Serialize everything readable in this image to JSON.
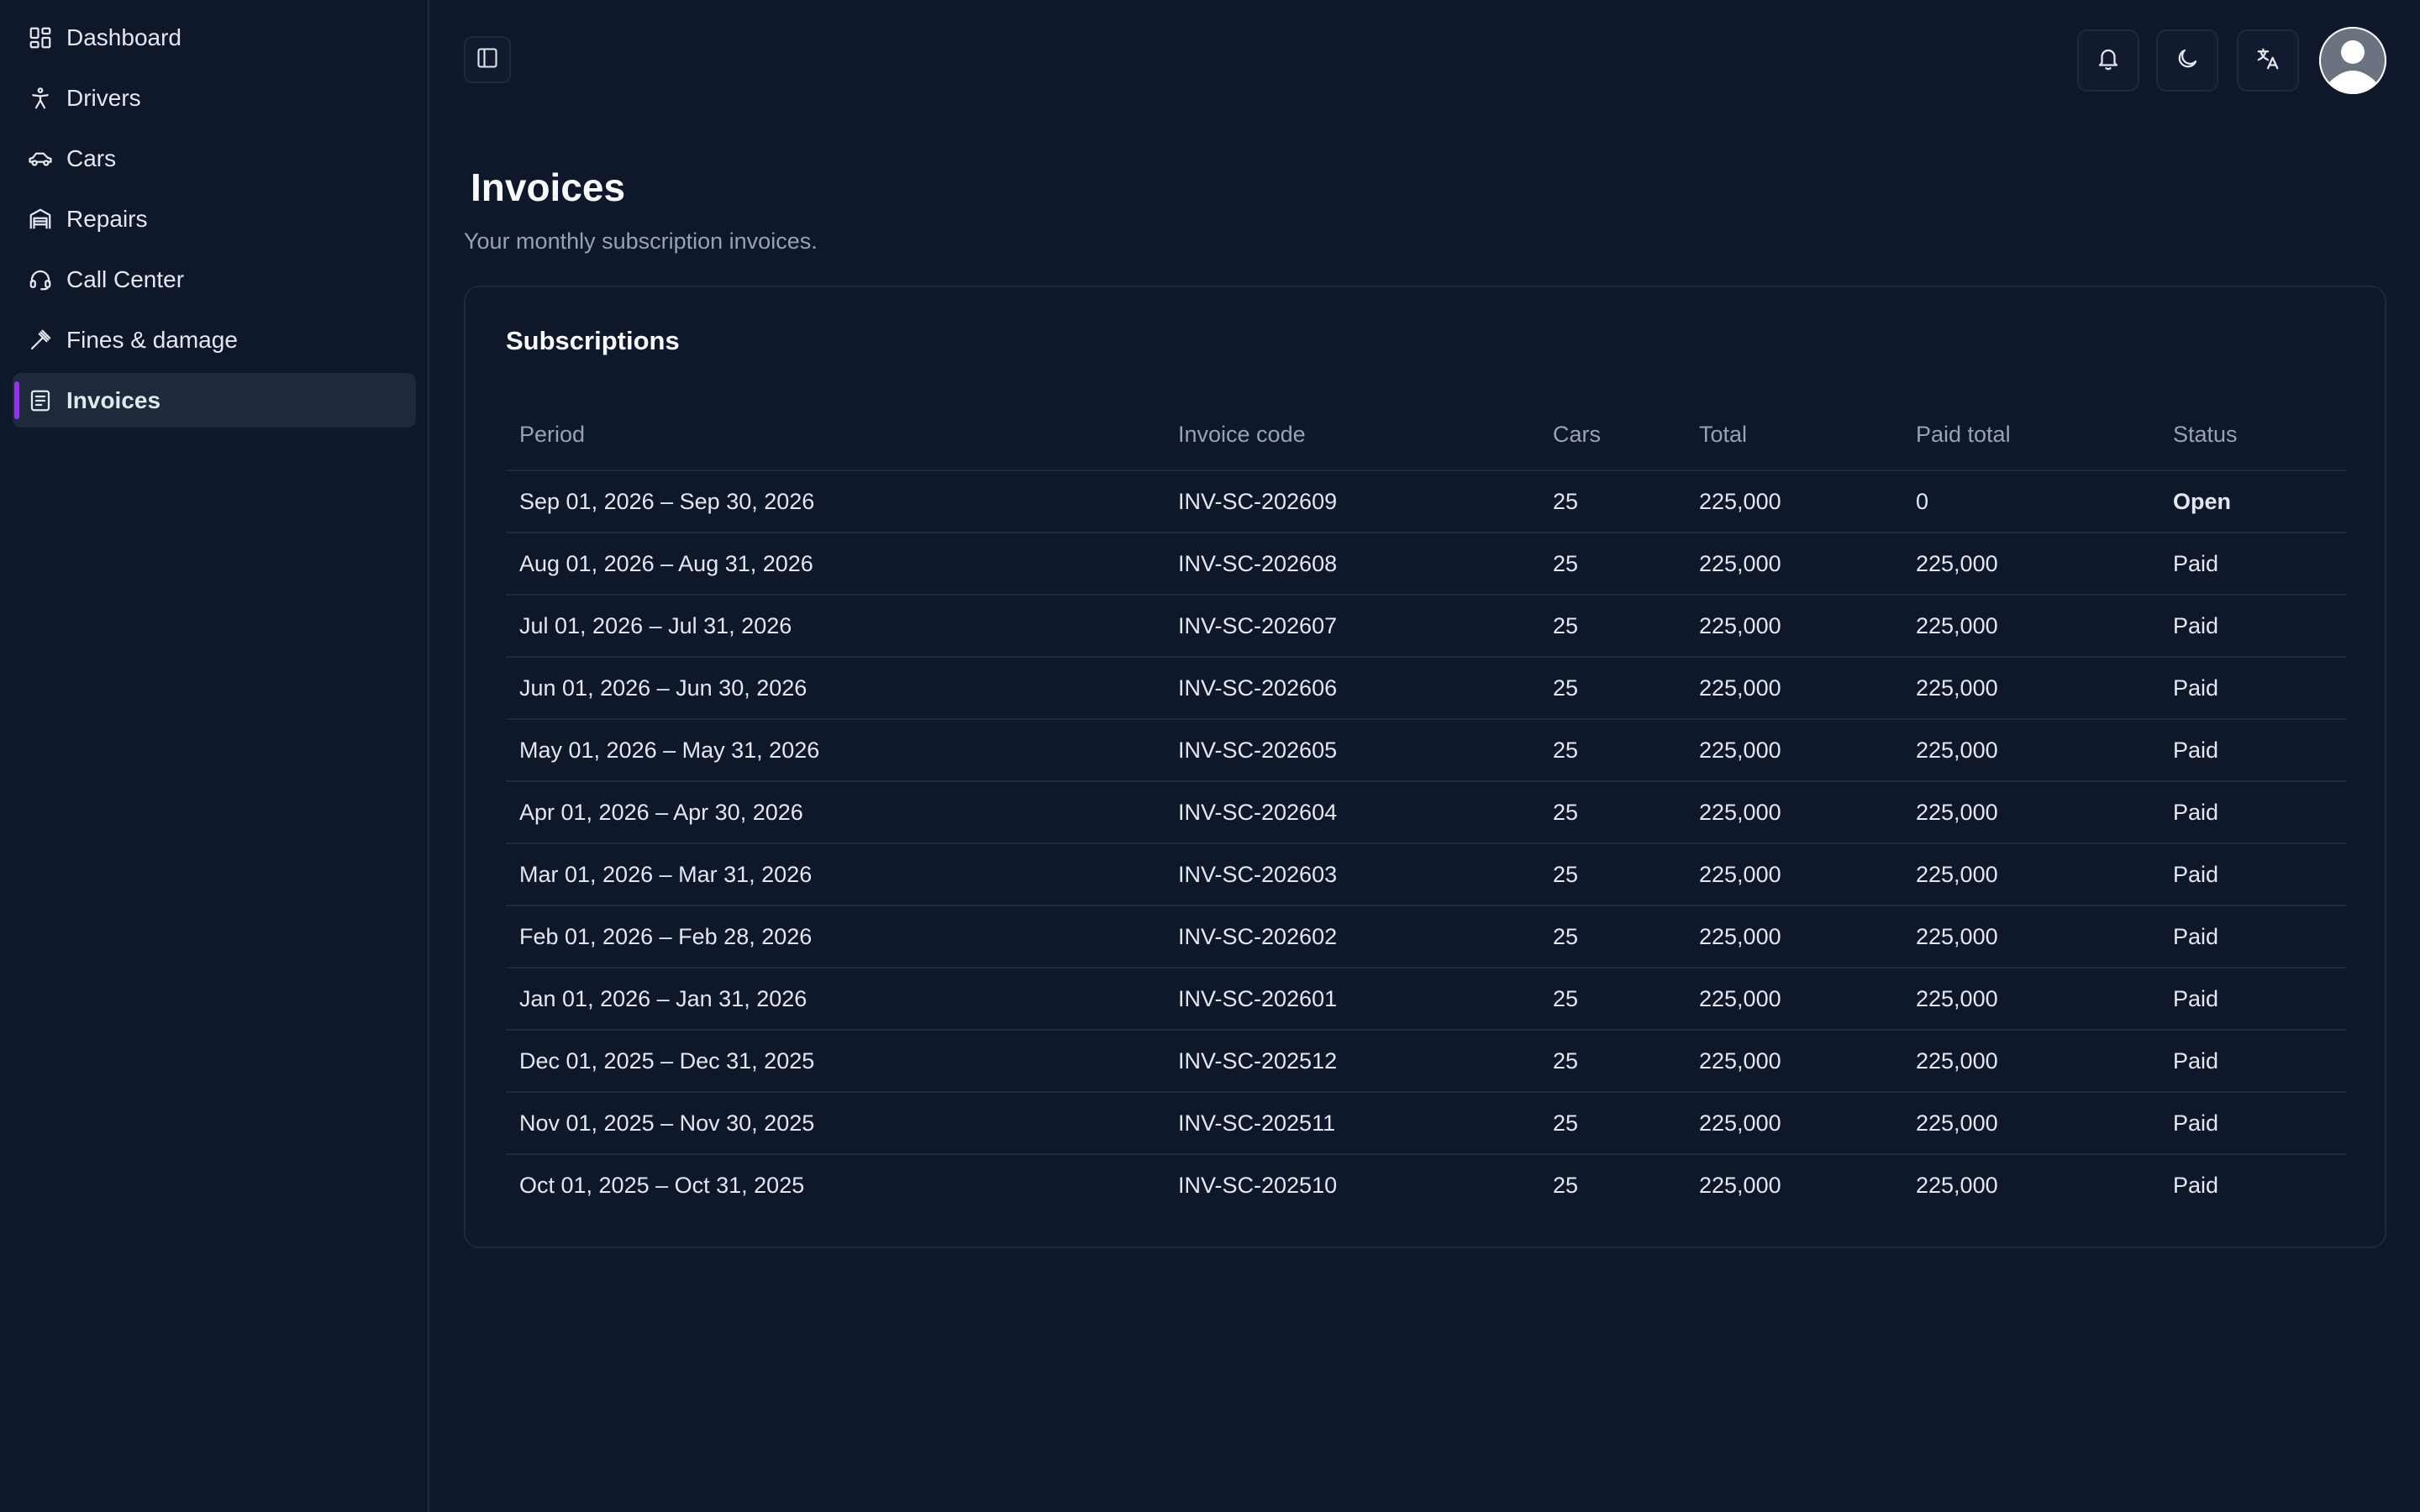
{
  "sidebar": {
    "items": [
      {
        "label": "Dashboard",
        "icon": "dashboard-icon"
      },
      {
        "label": "Drivers",
        "icon": "person-icon"
      },
      {
        "label": "Cars",
        "icon": "car-icon"
      },
      {
        "label": "Repairs",
        "icon": "garage-icon"
      },
      {
        "label": "Call Center",
        "icon": "headset-icon"
      },
      {
        "label": "Fines & damage",
        "icon": "gavel-icon"
      },
      {
        "label": "Invoices",
        "icon": "invoice-icon",
        "active": true
      }
    ]
  },
  "header": {
    "icons": [
      "sidebar-toggle-icon",
      "bell-icon",
      "moon-icon",
      "translate-icon",
      "avatar"
    ]
  },
  "page": {
    "title": "Invoices",
    "subtitle": "Your monthly subscription invoices."
  },
  "card": {
    "title": "Subscriptions",
    "columns": [
      "Period",
      "Invoice code",
      "Cars",
      "Total",
      "Paid total",
      "Status"
    ],
    "rows": [
      {
        "period": "Sep 01, 2026 – Sep 30, 2026",
        "code": "INV-SC-202609",
        "cars": "25",
        "total": "225,000",
        "paid": "0",
        "status": "Open"
      },
      {
        "period": "Aug 01, 2026 – Aug 31, 2026",
        "code": "INV-SC-202608",
        "cars": "25",
        "total": "225,000",
        "paid": "225,000",
        "status": "Paid"
      },
      {
        "period": "Jul 01, 2026 – Jul 31, 2026",
        "code": "INV-SC-202607",
        "cars": "25",
        "total": "225,000",
        "paid": "225,000",
        "status": "Paid"
      },
      {
        "period": "Jun 01, 2026 – Jun 30, 2026",
        "code": "INV-SC-202606",
        "cars": "25",
        "total": "225,000",
        "paid": "225,000",
        "status": "Paid"
      },
      {
        "period": "May 01, 2026 – May 31, 2026",
        "code": "INV-SC-202605",
        "cars": "25",
        "total": "225,000",
        "paid": "225,000",
        "status": "Paid"
      },
      {
        "period": "Apr 01, 2026 – Apr 30, 2026",
        "code": "INV-SC-202604",
        "cars": "25",
        "total": "225,000",
        "paid": "225,000",
        "status": "Paid"
      },
      {
        "period": "Mar 01, 2026 – Mar 31, 2026",
        "code": "INV-SC-202603",
        "cars": "25",
        "total": "225,000",
        "paid": "225,000",
        "status": "Paid"
      },
      {
        "period": "Feb 01, 2026 – Feb 28, 2026",
        "code": "INV-SC-202602",
        "cars": "25",
        "total": "225,000",
        "paid": "225,000",
        "status": "Paid"
      },
      {
        "period": "Jan 01, 2026 – Jan 31, 2026",
        "code": "INV-SC-202601",
        "cars": "25",
        "total": "225,000",
        "paid": "225,000",
        "status": "Paid"
      },
      {
        "period": "Dec 01, 2025 – Dec 31, 2025",
        "code": "INV-SC-202512",
        "cars": "25",
        "total": "225,000",
        "paid": "225,000",
        "status": "Paid"
      },
      {
        "period": "Nov 01, 2025 – Nov 30, 2025",
        "code": "INV-SC-202511",
        "cars": "25",
        "total": "225,000",
        "paid": "225,000",
        "status": "Paid"
      },
      {
        "period": "Oct 01, 2025 – Oct 31, 2025",
        "code": "INV-SC-202510",
        "cars": "25",
        "total": "225,000",
        "paid": "225,000",
        "status": "Paid"
      }
    ]
  },
  "colors": {
    "background": "#0f172a",
    "active_item_bg": "#1e293b",
    "active_accent": "#9333ea",
    "status_open": "#dc2626",
    "muted_text": "#94a3b8"
  }
}
